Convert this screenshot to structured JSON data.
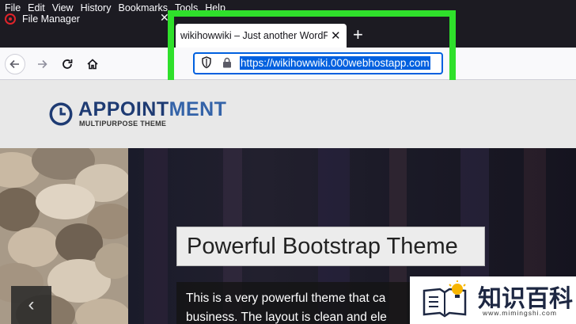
{
  "menubar": {
    "items": [
      "File",
      "Edit",
      "View",
      "History",
      "Bookmarks",
      "Tools",
      "Help"
    ]
  },
  "tabs": [
    {
      "title": "File Manager",
      "active": false
    },
    {
      "title": "wikihowwiki – Just another WordPress site",
      "active": true
    }
  ],
  "toolbar": {
    "new_tab": "+",
    "close": "✕"
  },
  "address_bar": {
    "url": "https://wikihowwiki.000webhostapp.com",
    "selected": true
  },
  "site": {
    "logo_title_a": "APPOINT",
    "logo_title_b": "MENT",
    "logo_subtitle": "MULTIPURPOSE THEME",
    "slide_title": "Powerful Bootstrap Theme",
    "slide_text_line1": "This is a very powerful theme that ca",
    "slide_text_line2": "business. The layout is clean and ele",
    "prev_arrow": "‹"
  },
  "watermark": {
    "title": "知识百科",
    "url": "www.mimingshi.com"
  },
  "colors": {
    "highlight": "#2fe02b",
    "url_selection": "#0060df",
    "chrome_dark": "#1c1b22",
    "logo_blue": "#1e3b73"
  }
}
